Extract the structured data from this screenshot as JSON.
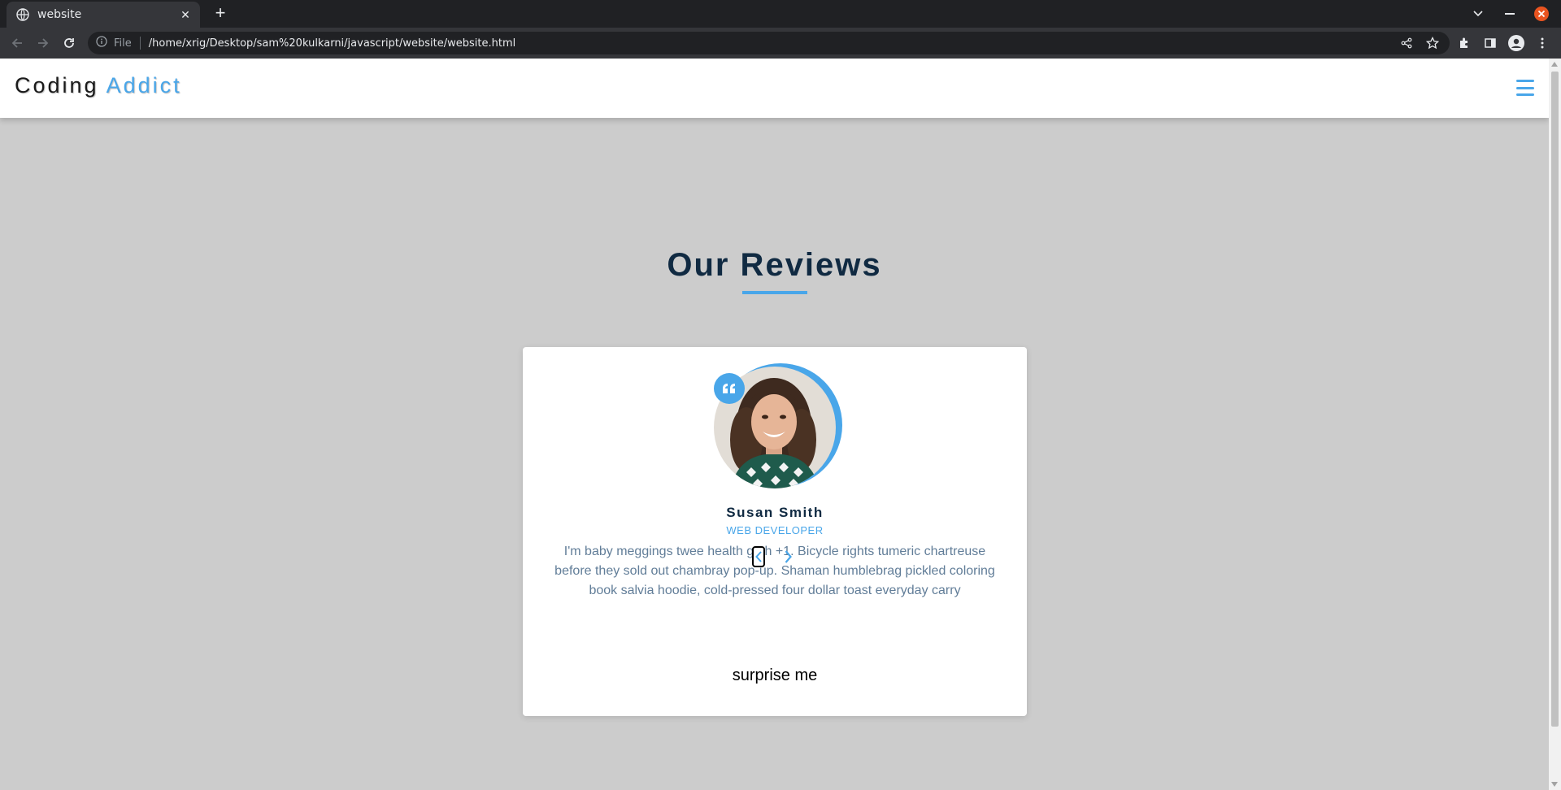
{
  "browser": {
    "tab_title": "website",
    "omnibox_scheme": "File",
    "url": "/home/xrig/Desktop/sam%20kulkarni/javascript/website/website.html"
  },
  "navbar": {
    "logo_part1": "Coding",
    "logo_part2": "Addict"
  },
  "section": {
    "title": "Our Reviews"
  },
  "review": {
    "author": "Susan Smith",
    "job": "web developer",
    "text": "I'm baby meggings twee health goth +1. Bicycle rights tumeric chartreuse before they sold out chambray pop-up. Shaman humblebrag pickled coloring book salvia hoodie, cold-pressed four dollar toast everyday carry",
    "random_button": "surprise me"
  },
  "colors": {
    "accent": "#49a6e9",
    "heading": "#102a42",
    "body_text": "#617d98",
    "page_bg": "#cccccc"
  },
  "icons": {
    "quote": "quote-icon",
    "prev": "chevron-left-icon",
    "next": "chevron-right-icon",
    "menu": "hamburger-icon"
  }
}
